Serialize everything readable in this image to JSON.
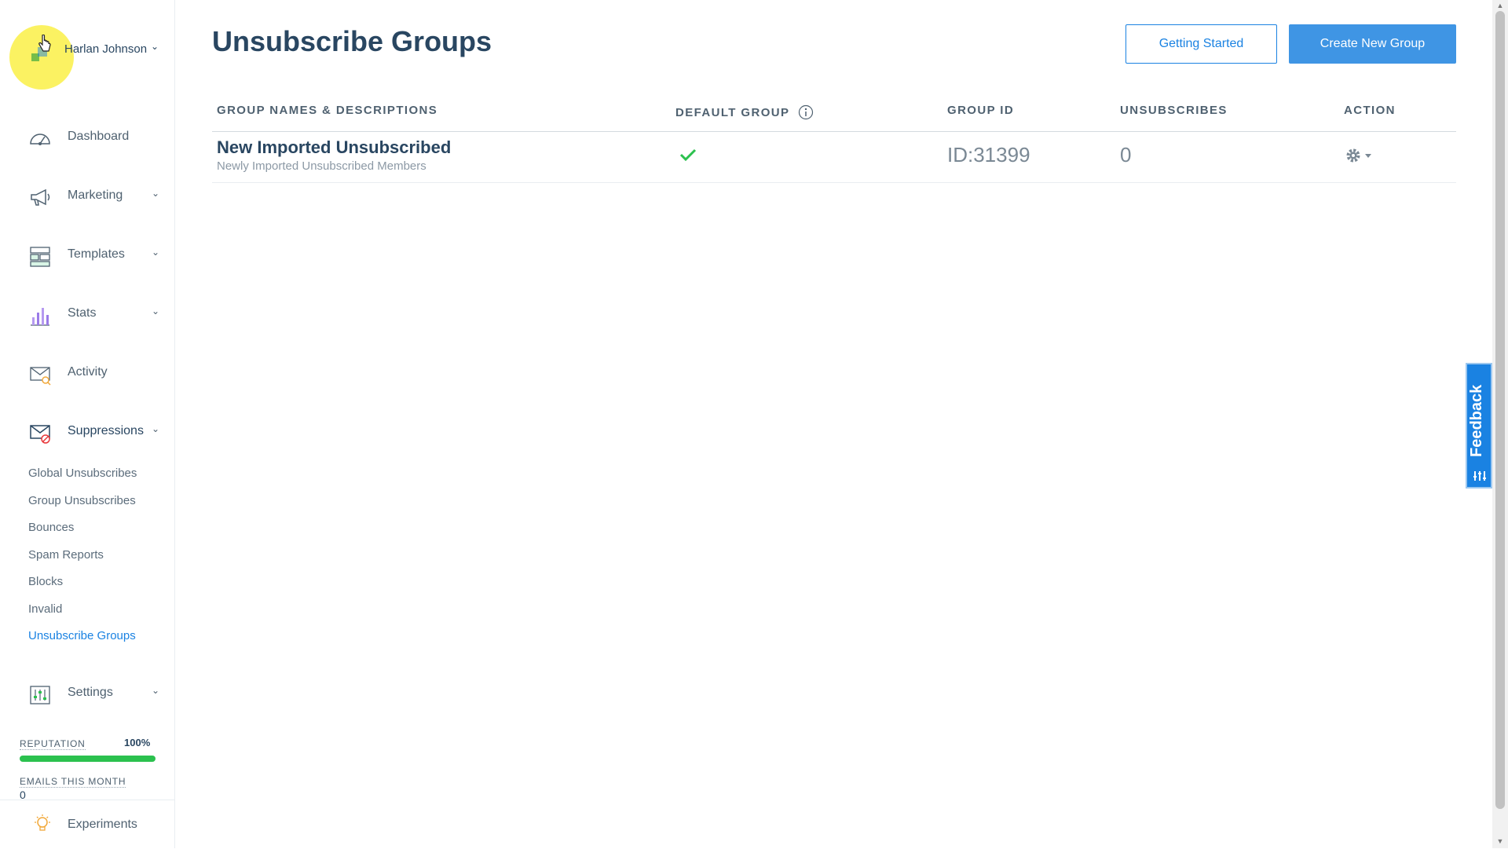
{
  "user": {
    "name": "Harlan Johnson",
    "chevron": "⌄"
  },
  "sidebar": {
    "nav": [
      {
        "label": "Dashboard",
        "icon": "dashboard-gauge-icon"
      },
      {
        "label": "Marketing",
        "icon": "megaphone-icon",
        "chevron": "⌄"
      },
      {
        "label": "Templates",
        "icon": "templates-icon",
        "chevron": "⌄"
      },
      {
        "label": "Stats",
        "icon": "bar-chart-icon",
        "chevron": "⌄"
      },
      {
        "label": "Activity",
        "icon": "activity-envelope-icon"
      },
      {
        "label": "Suppressions",
        "icon": "suppressions-envelope-icon",
        "chevron": "⌄"
      }
    ],
    "suppressions_sub": [
      "Global Unsubscribes",
      "Group Unsubscribes",
      "Bounces",
      "Spam Reports",
      "Blocks",
      "Invalid",
      "Unsubscribe Groups"
    ],
    "settings": {
      "label": "Settings",
      "icon": "settings-sliders-icon",
      "chevron": "⌄"
    },
    "reputation": {
      "label": "REPUTATION",
      "value": "100%",
      "fraction": 1.0
    },
    "emails": {
      "label": "EMAILS THIS MONTH",
      "value": "0"
    },
    "experiments": {
      "label": "Experiments",
      "icon": "lightbulb-icon"
    }
  },
  "page": {
    "title": "Unsubscribe Groups",
    "getting_started": "Getting Started",
    "create_group": "Create New Group"
  },
  "table": {
    "headers": {
      "names": "GROUP NAMES & DESCRIPTIONS",
      "default": "DEFAULT GROUP",
      "group_id": "GROUP ID",
      "unsubscribes": "UNSUBSCRIBES",
      "action": "ACTION"
    },
    "rows": [
      {
        "name": "New Imported Unsubscribed",
        "description": "Newly Imported Unsubscribed Members",
        "default": true,
        "group_id": "ID:31399",
        "unsubscribes": "0"
      }
    ]
  },
  "feedback": {
    "label": "Feedback"
  },
  "colors": {
    "accent": "#1a82e2",
    "text": "#294661",
    "success": "#2bc14e"
  }
}
